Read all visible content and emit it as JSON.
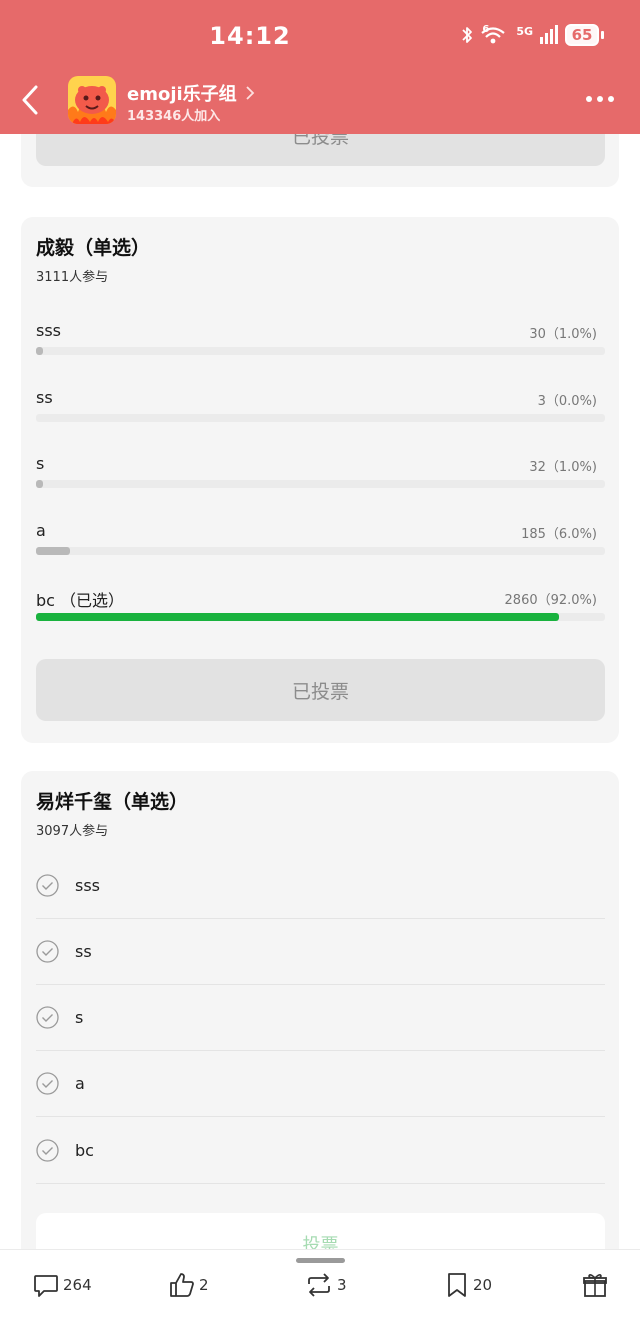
{
  "status_bar": {
    "time": "14:12",
    "battery": "65",
    "network": "5G",
    "wifi_sup": "6"
  },
  "header": {
    "group_name": "emoji乐子组",
    "members": "143346人加入"
  },
  "card_top": {
    "button_label": "已投票"
  },
  "poll1": {
    "title": "成毅（单选）",
    "participants": "3111人参与",
    "options": [
      {
        "label": "sss",
        "count": "30（1.0%)",
        "pct": 1.0,
        "selected": false
      },
      {
        "label": "ss",
        "count": "3（0.0%)",
        "pct": 0.0,
        "selected": false
      },
      {
        "label": "s",
        "count": "32（1.0%)",
        "pct": 1.0,
        "selected": false
      },
      {
        "label": "a",
        "count": "185（6.0%)",
        "pct": 6.0,
        "selected": false
      },
      {
        "label": "bc （已选）",
        "count": "2860（92.0%)",
        "pct": 92.0,
        "selected": true
      }
    ],
    "button_label": "已投票"
  },
  "poll2": {
    "title": "易烊千玺（单选）",
    "participants": "3097人参与",
    "options": [
      {
        "label": "sss"
      },
      {
        "label": "ss"
      },
      {
        "label": "s"
      },
      {
        "label": "a"
      },
      {
        "label": "bc"
      }
    ],
    "button_label": "投票"
  },
  "bottom_bar": {
    "comments": "264",
    "likes": "2",
    "reposts": "3",
    "favorites": "20"
  },
  "colors": {
    "header": "#e66a6a",
    "selected_bar": "#19b23e",
    "bar": "#b9b9b9",
    "card": "#f5f5f5"
  }
}
